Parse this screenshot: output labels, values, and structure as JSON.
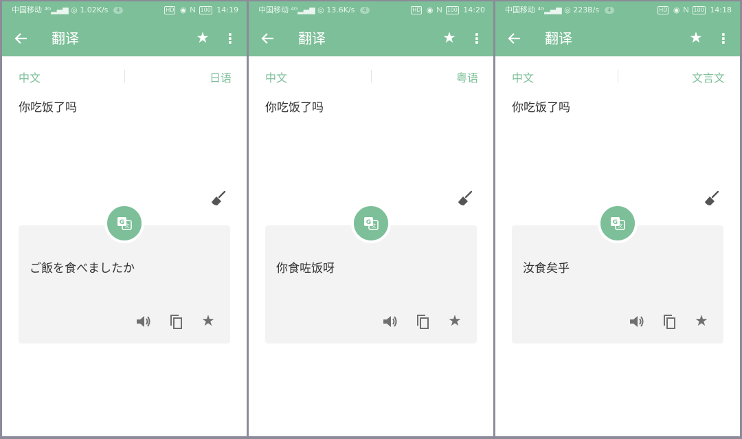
{
  "screens": [
    {
      "status": {
        "carrier": "中国移动",
        "net": "1.02K/s",
        "badge": "4",
        "battery": "100",
        "time": "14:19"
      },
      "toolbar": {
        "title": "翻译"
      },
      "source_lang": "中文",
      "target_lang": "日语",
      "input_text": "你吃饭了吗",
      "result_text": "ご飯を食べましたか"
    },
    {
      "status": {
        "carrier": "中国移动",
        "net": "13.6K/s",
        "badge": "4",
        "battery": "100",
        "time": "14:20"
      },
      "toolbar": {
        "title": "翻译"
      },
      "source_lang": "中文",
      "target_lang": "粤语",
      "input_text": "你吃饭了吗",
      "result_text": "你食咗饭呀"
    },
    {
      "status": {
        "carrier": "中国移动",
        "net": "223B/s",
        "badge": "4",
        "battery": "100",
        "time": "14:18"
      },
      "toolbar": {
        "title": "翻译"
      },
      "source_lang": "中文",
      "target_lang": "文言文",
      "input_text": "你吃饭了吗",
      "result_text": "汝食矣乎"
    }
  ],
  "icons": {
    "back": "arrow-left-icon",
    "favorite": "star-icon",
    "more": "more-vertical-icon",
    "clear": "broom-icon",
    "translate": "translate-icon",
    "speak": "speaker-icon",
    "copy": "copy-icon"
  },
  "colors": {
    "primary": "#7cbf98",
    "background": "#8d8a99",
    "result_background": "#f3f3f3",
    "text": "#333333"
  }
}
